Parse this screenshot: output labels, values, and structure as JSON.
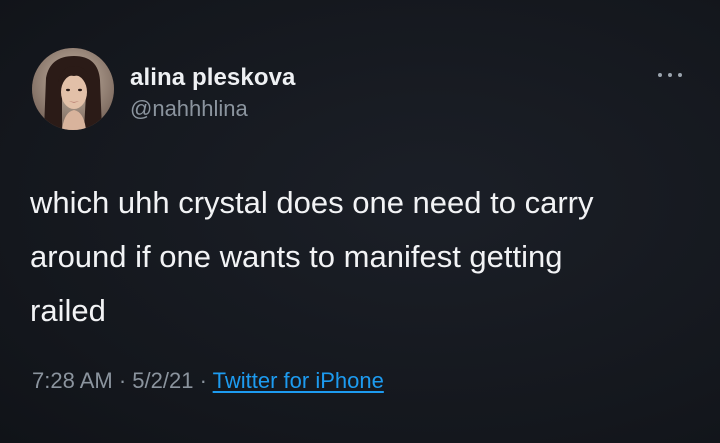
{
  "tweet": {
    "author_name": "alina pleskova",
    "author_handle": "@nahhhlina",
    "text_lines": [
      "which uhh crystal does one need to carry",
      "around if one wants to manifest getting",
      "railed"
    ],
    "time": "7:28 AM",
    "date": "5/2/21",
    "separator": "·",
    "source": "Twitter for iPhone"
  },
  "colors": {
    "background": "#15181f",
    "text": "#f2f3f5",
    "secondary_text": "#8b949e",
    "link": "#1d9bf0"
  },
  "icons": {
    "more": "more-horizontal-icon"
  }
}
